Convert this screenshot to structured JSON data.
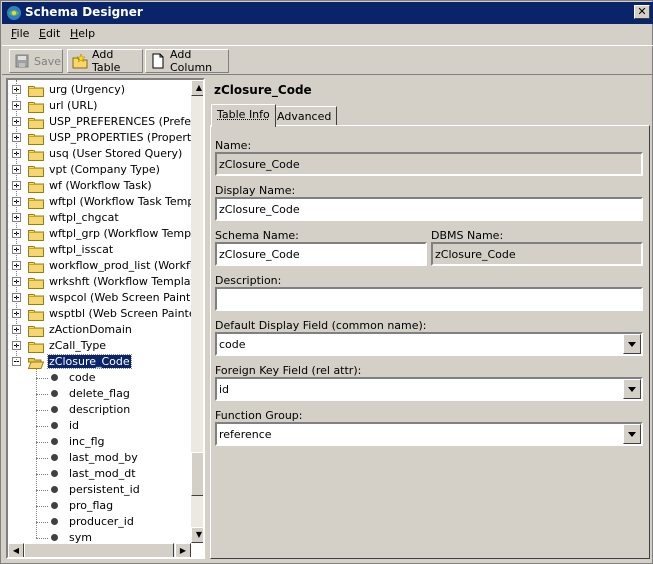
{
  "window": {
    "title": "Schema Designer",
    "close_label": "✕"
  },
  "menu": [
    {
      "mnemonic": "F",
      "rest": "ile"
    },
    {
      "mnemonic": "E",
      "rest": "dit"
    },
    {
      "mnemonic": "H",
      "rest": "elp"
    }
  ],
  "toolbar": {
    "save_label": "Save",
    "add_table_label": "Add Table",
    "add_column_label": "Add Column"
  },
  "tree": {
    "tables": [
      "urg (Urgency)",
      "url (URL)",
      "USP_PREFERENCES (Prefere",
      "USP_PROPERTIES (Property)",
      "usq (User Stored Query)",
      "vpt (Company Type)",
      "wf (Workflow Task)",
      "wftpl (Workflow Task Template",
      "wftpl_chgcat",
      "wftpl_grp (Workflow Templat",
      "wftpl_isscat",
      "workflow_prod_list (Workflov",
      "wrkshft (Workflow Template",
      "wspcol (Web Screen Painter",
      "wsptbl (Web Screen Painter",
      "zActionDomain",
      "zCall_Type"
    ],
    "selected_table": "zClosure_Code",
    "columns": [
      "code",
      "delete_flag",
      "description",
      "id",
      "inc_flg",
      "last_mod_by",
      "last_mod_dt",
      "persistent_id",
      "pro_flag",
      "producer_id",
      "sym"
    ]
  },
  "detail": {
    "title": "zClosure_Code",
    "tabs": {
      "table_info": "Table Info",
      "advanced": "Advanced"
    },
    "name_label": "Name:",
    "name_value": "zClosure_Code",
    "display_name_label": "Display Name:",
    "display_name_value": "zClosure_Code",
    "schema_name_label": "Schema Name:",
    "schema_name_value": "zClosure_Code",
    "dbms_name_label": "DBMS Name:",
    "dbms_name_value": "zClosure_Code",
    "description_label": "Description:",
    "description_value": "",
    "default_display_label": "Default Display Field (common name):",
    "default_display_value": "code",
    "foreign_key_label": "Foreign Key Field (rel attr):",
    "foreign_key_value": "id",
    "function_group_label": "Function Group:",
    "function_group_value": "reference"
  },
  "scroll": {
    "vertical_position": 0.92
  }
}
